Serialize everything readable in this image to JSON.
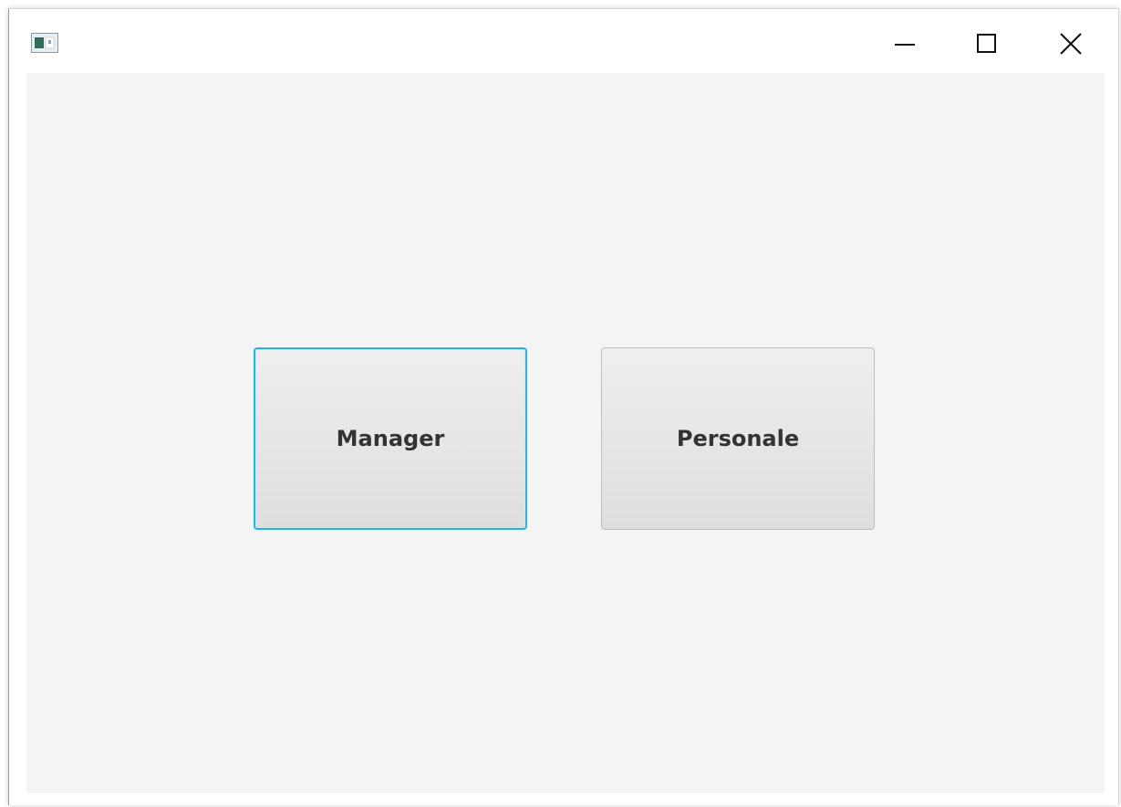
{
  "window": {
    "icon": "java-app-icon",
    "controls": {
      "minimize": "minimize-icon",
      "maximize": "maximize-icon",
      "close": "close-icon"
    }
  },
  "main": {
    "buttons": [
      {
        "label": "Manager",
        "focused": true
      },
      {
        "label": "Personale",
        "focused": false
      }
    ]
  },
  "colors": {
    "focus_ring": "#2ab3e0",
    "content_background": "#f4f4f4",
    "button_text": "#333333"
  }
}
